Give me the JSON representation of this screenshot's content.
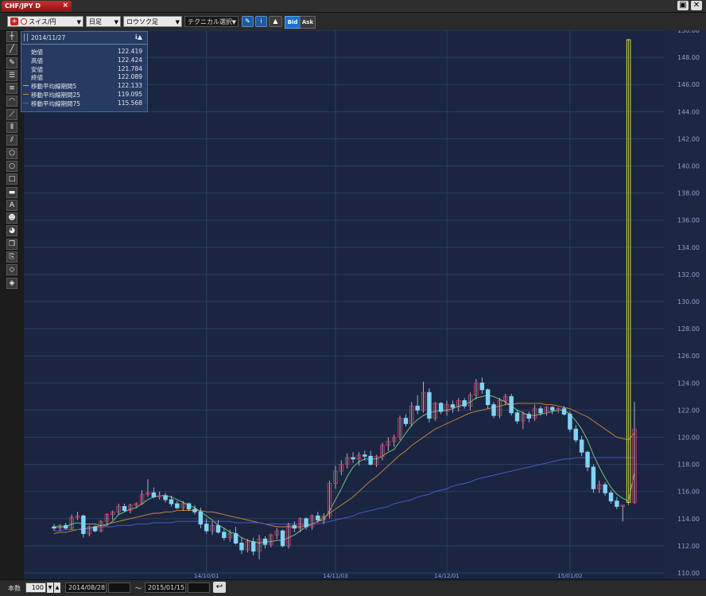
{
  "window": {
    "tab_label": "CHF/JPY D",
    "tab_close": "×",
    "restore_glyph": "▣",
    "close_glyph": "✕"
  },
  "toolbar": {
    "pair": "スイス/円",
    "timeframe": "日足",
    "chart_style": "ロウソク足",
    "technical": "テクニカル選択",
    "bid": "Bid",
    "ask": "Ask"
  },
  "tools": [
    {
      "name": "crosshair-icon",
      "glyph": "┼"
    },
    {
      "name": "trendline-icon",
      "glyph": "╱"
    },
    {
      "name": "ruler-icon",
      "glyph": "✎"
    },
    {
      "name": "horizontal-lines-icon",
      "glyph": "☰"
    },
    {
      "name": "fibonacci-icon",
      "glyph": "≡"
    },
    {
      "name": "arc-icon",
      "glyph": "◠"
    },
    {
      "name": "fan-icon",
      "glyph": "⟋"
    },
    {
      "name": "vertical-lines-icon",
      "glyph": "⦀"
    },
    {
      "name": "channel-icon",
      "glyph": "⫽"
    },
    {
      "name": "pentagon-icon",
      "glyph": "⬠"
    },
    {
      "name": "circle-icon",
      "glyph": "○"
    },
    {
      "name": "rectangle-icon",
      "glyph": "□"
    },
    {
      "name": "hline-icon",
      "glyph": "▬"
    },
    {
      "name": "text-icon",
      "glyph": "A"
    },
    {
      "name": "face-icon",
      "glyph": "☻"
    },
    {
      "name": "stamp-icon",
      "glyph": "◕"
    },
    {
      "name": "copy-icon",
      "glyph": "❐"
    },
    {
      "name": "paste-icon",
      "glyph": "⎘"
    },
    {
      "name": "eraser-icon",
      "glyph": "◇"
    },
    {
      "name": "erase-all-icon",
      "glyph": "◈"
    }
  ],
  "info": {
    "date": "2014/11/27",
    "rows": [
      {
        "label": "始値",
        "value": "122.419",
        "color": ""
      },
      {
        "label": "高値",
        "value": "122.424",
        "color": ""
      },
      {
        "label": "安値",
        "value": "121.784",
        "color": ""
      },
      {
        "label": "終値",
        "value": "122.089",
        "color": ""
      },
      {
        "label": "移動平均線期間5",
        "value": "122.133",
        "color": "#7cd07c"
      },
      {
        "label": "移動平均線期間25",
        "value": "119.095",
        "color": "#d08a3c"
      },
      {
        "label": "移動平均線期間75",
        "value": "115.568",
        "color": "#4a5ed8"
      }
    ]
  },
  "status": {
    "count_label": "本数",
    "count_value": "100",
    "from_date": "2014/08/28",
    "tilde": "〜",
    "to_date": "2015/01/15"
  },
  "chart_data": {
    "type": "candlestick",
    "ylim": [
      110,
      150
    ],
    "y_ticks": [
      "110.00",
      "112.00",
      "114.00",
      "116.00",
      "118.00",
      "120.00",
      "122.00",
      "124.00",
      "126.00",
      "128.00",
      "130.00",
      "132.00",
      "134.00",
      "136.00",
      "138.00",
      "140.00",
      "142.00",
      "144.00",
      "146.00",
      "148.00",
      "150.00"
    ],
    "x_labels": [
      {
        "label": "14/10/01",
        "index": 26
      },
      {
        "label": "14/11/03",
        "index": 48
      },
      {
        "label": "14/12/01",
        "index": 67
      },
      {
        "label": "15/01/02",
        "index": 88
      }
    ],
    "candles": [
      [
        113.4,
        113.6,
        113.1,
        113.3
      ],
      [
        113.3,
        113.6,
        113.1,
        113.5
      ],
      [
        113.5,
        113.7,
        113.2,
        113.3
      ],
      [
        113.3,
        114.3,
        113.2,
        114.1
      ],
      [
        114.1,
        114.5,
        113.9,
        114.2
      ],
      [
        114.2,
        114.3,
        112.6,
        112.9
      ],
      [
        112.9,
        113.5,
        112.7,
        113.4
      ],
      [
        113.4,
        113.5,
        113.0,
        113.1
      ],
      [
        113.1,
        113.9,
        113.0,
        113.8
      ],
      [
        113.8,
        114.4,
        113.6,
        114.3
      ],
      [
        114.3,
        114.6,
        113.9,
        114.5
      ],
      [
        114.5,
        115.1,
        114.3,
        114.9
      ],
      [
        114.9,
        115.1,
        114.5,
        114.6
      ],
      [
        114.6,
        115.1,
        114.4,
        115.0
      ],
      [
        115.0,
        115.2,
        114.8,
        115.1
      ],
      [
        115.1,
        116.1,
        115.0,
        115.8
      ],
      [
        115.8,
        116.9,
        115.6,
        115.9
      ],
      [
        115.9,
        116.3,
        115.5,
        115.6
      ],
      [
        115.6,
        116.0,
        115.4,
        115.7
      ],
      [
        115.7,
        115.9,
        115.2,
        115.4
      ],
      [
        115.4,
        115.7,
        114.9,
        115.1
      ],
      [
        115.1,
        115.3,
        114.7,
        114.8
      ],
      [
        114.8,
        115.3,
        114.6,
        115.1
      ],
      [
        115.1,
        115.2,
        114.6,
        114.7
      ],
      [
        114.7,
        115.0,
        114.3,
        114.5
      ],
      [
        114.5,
        114.8,
        113.3,
        113.6
      ],
      [
        113.6,
        114.0,
        112.9,
        113.1
      ],
      [
        113.1,
        113.8,
        112.8,
        113.5
      ],
      [
        113.5,
        113.9,
        112.9,
        113.0
      ],
      [
        113.0,
        113.3,
        112.4,
        112.6
      ],
      [
        112.6,
        113.2,
        112.3,
        112.9
      ],
      [
        112.9,
        113.4,
        112.1,
        112.2
      ],
      [
        112.2,
        112.6,
        111.4,
        111.7
      ],
      [
        111.7,
        112.5,
        111.5,
        112.3
      ],
      [
        112.3,
        112.6,
        111.3,
        111.6
      ],
      [
        111.6,
        112.8,
        111.0,
        112.5
      ],
      [
        112.5,
        112.7,
        111.8,
        112.1
      ],
      [
        112.1,
        112.9,
        111.9,
        112.8
      ],
      [
        112.8,
        113.3,
        112.5,
        113.1
      ],
      [
        113.1,
        113.2,
        111.9,
        112.0
      ],
      [
        112.0,
        113.7,
        111.8,
        113.5
      ],
      [
        113.5,
        113.8,
        113.0,
        113.3
      ],
      [
        113.3,
        114.1,
        113.0,
        114.0
      ],
      [
        114.0,
        114.1,
        113.2,
        113.4
      ],
      [
        113.4,
        114.3,
        113.2,
        114.2
      ],
      [
        114.2,
        114.5,
        113.7,
        113.9
      ],
      [
        113.9,
        114.4,
        113.6,
        114.2
      ],
      [
        114.2,
        116.8,
        114.0,
        116.6
      ],
      [
        116.6,
        117.9,
        116.2,
        117.5
      ],
      [
        117.5,
        118.3,
        117.2,
        118.0
      ],
      [
        118.0,
        118.8,
        117.7,
        118.5
      ],
      [
        118.5,
        118.9,
        118.1,
        118.4
      ],
      [
        118.4,
        118.9,
        117.9,
        118.7
      ],
      [
        118.7,
        119.0,
        118.3,
        118.6
      ],
      [
        118.6,
        119.0,
        117.9,
        118.0
      ],
      [
        118.0,
        118.7,
        117.8,
        118.6
      ],
      [
        118.6,
        119.6,
        118.3,
        119.4
      ],
      [
        119.4,
        120.0,
        119.0,
        119.7
      ],
      [
        119.7,
        120.2,
        119.3,
        120.0
      ],
      [
        120.0,
        121.6,
        119.8,
        121.4
      ],
      [
        121.4,
        121.7,
        120.8,
        121.0
      ],
      [
        121.0,
        122.6,
        120.8,
        122.3
      ],
      [
        122.3,
        123.1,
        121.7,
        122.0
      ],
      [
        122.0,
        124.1,
        121.8,
        123.3
      ],
      [
        123.3,
        123.6,
        121.1,
        121.4
      ],
      [
        121.4,
        122.6,
        121.2,
        122.5
      ],
      [
        122.5,
        122.6,
        121.7,
        121.9
      ],
      [
        121.9,
        122.7,
        121.6,
        122.4
      ],
      [
        122.4,
        122.7,
        121.8,
        122.2
      ],
      [
        122.2,
        122.9,
        121.9,
        122.7
      ],
      [
        122.7,
        122.9,
        122.1,
        122.3
      ],
      [
        122.3,
        123.3,
        122.0,
        123.1
      ],
      [
        123.1,
        124.3,
        122.8,
        124.0
      ],
      [
        124.0,
        124.4,
        123.2,
        123.5
      ],
      [
        123.5,
        123.6,
        122.1,
        122.4
      ],
      [
        122.4,
        122.6,
        121.4,
        121.6
      ],
      [
        121.6,
        122.9,
        121.4,
        122.7
      ],
      [
        122.7,
        123.2,
        122.4,
        123.0
      ],
      [
        123.0,
        123.2,
        121.6,
        121.8
      ],
      [
        121.8,
        122.0,
        121.0,
        121.2
      ],
      [
        121.2,
        121.9,
        120.6,
        121.7
      ],
      [
        121.7,
        121.9,
        121.1,
        121.4
      ],
      [
        121.4,
        122.4,
        121.2,
        122.1
      ],
      [
        122.1,
        122.3,
        121.6,
        121.8
      ],
      [
        121.8,
        122.3,
        121.6,
        122.2
      ],
      [
        122.2,
        122.3,
        121.7,
        122.0
      ],
      [
        122.0,
        122.2,
        121.8,
        122.1
      ],
      [
        122.1,
        122.3,
        121.6,
        121.7
      ],
      [
        121.7,
        121.9,
        120.4,
        120.6
      ],
      [
        120.6,
        120.9,
        119.6,
        119.8
      ],
      [
        119.8,
        120.1,
        118.6,
        118.9
      ],
      [
        118.9,
        119.0,
        117.5,
        117.8
      ],
      [
        117.8,
        118.0,
        115.9,
        116.2
      ],
      [
        116.2,
        116.8,
        115.9,
        116.5
      ],
      [
        116.5,
        116.7,
        115.7,
        115.9
      ],
      [
        115.9,
        116.1,
        115.1,
        115.3
      ],
      [
        115.3,
        115.6,
        114.7,
        114.9
      ],
      [
        114.9,
        115.0,
        113.8,
        115.0
      ],
      [
        115.0,
        149.3,
        115.0,
        115.2
      ],
      [
        115.2,
        122.6,
        115.1,
        120.6
      ]
    ],
    "series": [
      {
        "name": "移動平均線期間5",
        "color": "#7cd07c",
        "values": [
          113.4,
          113.4,
          113.4,
          113.6,
          113.7,
          113.6,
          113.6,
          113.6,
          113.5,
          113.5,
          113.8,
          114.3,
          114.5,
          114.7,
          114.8,
          115.1,
          115.4,
          115.6,
          115.7,
          115.7,
          115.6,
          115.4,
          115.2,
          115.0,
          114.8,
          114.5,
          114.2,
          113.9,
          113.5,
          113.3,
          113.0,
          112.9,
          112.6,
          112.4,
          112.3,
          112.2,
          112.3,
          112.3,
          112.4,
          112.4,
          112.6,
          112.8,
          113.1,
          113.4,
          113.6,
          113.8,
          113.9,
          114.6,
          115.4,
          116.2,
          117.1,
          117.8,
          118.2,
          118.4,
          118.4,
          118.4,
          118.6,
          118.9,
          119.1,
          119.7,
          120.3,
          120.9,
          121.3,
          121.6,
          121.8,
          121.9,
          122.0,
          122.0,
          122.1,
          122.3,
          122.4,
          122.6,
          122.9,
          123.0,
          123.1,
          123.0,
          122.8,
          122.6,
          122.3,
          122.0,
          121.8,
          121.6,
          121.6,
          121.7,
          121.8,
          121.9,
          122.0,
          122.0,
          121.7,
          121.2,
          120.6,
          119.8,
          118.7,
          117.8,
          117.0,
          116.3,
          115.8,
          115.5,
          115.3,
          117.4
        ]
      },
      {
        "name": "移動平均線期間25",
        "color": "#d08a3c",
        "values": [
          112.9,
          113.0,
          113.0,
          113.1,
          113.2,
          113.2,
          113.3,
          113.4,
          113.5,
          113.6,
          113.7,
          113.8,
          113.9,
          114.0,
          114.1,
          114.2,
          114.3,
          114.4,
          114.4,
          114.5,
          114.5,
          114.6,
          114.6,
          114.6,
          114.6,
          114.6,
          114.5,
          114.5,
          114.4,
          114.3,
          114.2,
          114.1,
          114.0,
          113.9,
          113.8,
          113.7,
          113.6,
          113.5,
          113.4,
          113.4,
          113.4,
          113.4,
          113.4,
          113.5,
          113.6,
          113.8,
          114.1,
          114.4,
          114.7,
          115.0,
          115.3,
          115.6,
          116.0,
          116.4,
          116.8,
          117.1,
          117.5,
          117.9,
          118.3,
          118.7,
          119.0,
          119.4,
          119.7,
          120.0,
          120.3,
          120.6,
          120.8,
          121.0,
          121.2,
          121.4,
          121.6,
          121.8,
          121.9,
          122.0,
          122.1,
          122.2,
          122.3,
          122.4,
          122.4,
          122.5,
          122.5,
          122.5,
          122.5,
          122.5,
          122.4,
          122.4,
          122.3,
          122.2,
          122.1,
          121.9,
          121.7,
          121.5,
          121.2,
          120.9,
          120.6,
          120.3,
          120.0,
          119.9,
          119.8,
          120.3
        ]
      },
      {
        "name": "移動平均線期間75",
        "color": "#4a5ed8",
        "values": [
          113.1,
          113.1,
          113.2,
          113.2,
          113.2,
          113.3,
          113.3,
          113.3,
          113.4,
          113.4,
          113.4,
          113.5,
          113.5,
          113.5,
          113.6,
          113.6,
          113.6,
          113.7,
          113.7,
          113.7,
          113.7,
          113.8,
          113.8,
          113.8,
          113.8,
          113.8,
          113.8,
          113.8,
          113.8,
          113.8,
          113.8,
          113.7,
          113.7,
          113.7,
          113.7,
          113.7,
          113.6,
          113.6,
          113.6,
          113.6,
          113.6,
          113.6,
          113.6,
          113.6,
          113.6,
          113.6,
          113.7,
          113.8,
          113.9,
          114.0,
          114.1,
          114.2,
          114.4,
          114.5,
          114.6,
          114.7,
          114.8,
          114.9,
          115.1,
          115.2,
          115.3,
          115.4,
          115.6,
          115.7,
          115.8,
          116.0,
          116.1,
          116.2,
          116.4,
          116.5,
          116.6,
          116.7,
          116.9,
          117.0,
          117.1,
          117.2,
          117.3,
          117.4,
          117.5,
          117.6,
          117.7,
          117.8,
          117.9,
          118.0,
          118.1,
          118.2,
          118.3,
          118.4,
          118.4,
          118.5,
          118.5,
          118.5,
          118.5,
          118.5,
          118.5,
          118.5,
          118.5,
          118.5,
          118.5,
          118.5
        ]
      }
    ],
    "axis_color": "#8aa0cc",
    "background": "#1a2542",
    "grid_color": "#2e3d62",
    "up_color": "#d23c5a",
    "down_color": "#7fd4f4",
    "spike_color": "#e0e040"
  }
}
